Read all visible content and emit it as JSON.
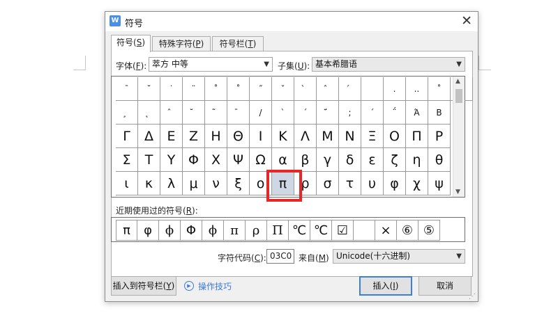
{
  "dialog": {
    "title": "符号",
    "app_icon_letter": "W",
    "close_glyph": "✕",
    "tabs": [
      {
        "label": "符号(",
        "key": "S",
        "tail": ")"
      },
      {
        "label": "特殊字符(",
        "key": "P",
        "tail": ")"
      },
      {
        "label": "符号栏(",
        "key": "T",
        "tail": ")"
      }
    ],
    "font_label": "字体(",
    "font_key": "F",
    "font_tail": "):",
    "font_value": "萃方 中等",
    "subset_label": "子集(",
    "subset_key": "U",
    "subset_tail": "):",
    "subset_value": "基本希腊语",
    "combo_arrow": "▼",
    "grid": [
      [
        "ˉ",
        "˘",
        "˙",
        "¨",
        "˚",
        "˚",
        "˝",
        "ˇ",
        "̀",
        "̂",
        "́",
        "",
        ".",
        "..",
        "˚",
        "̦"
      ],
      [
        "̧",
        "̨",
        "̂",
        "̆",
        "̃",
        "̄",
        "/",
        "`",
        "´",
        "̈́",
        ";",
        "΄",
        "΅",
        "Ά",
        "Β"
      ],
      [
        "Γ",
        "Δ",
        "Ε",
        "Ζ",
        "Η",
        "Θ",
        "Ι",
        "Κ",
        "Λ",
        "Μ",
        "Ν",
        "Ξ",
        "Ο",
        "Π",
        "Ρ"
      ],
      [
        "Σ",
        "Τ",
        "Υ",
        "Φ",
        "Χ",
        "Ψ",
        "Ω",
        "α",
        "β",
        "γ",
        "δ",
        "ε",
        "ζ",
        "η",
        "θ"
      ],
      [
        "ι",
        "κ",
        "λ",
        "μ",
        "ν",
        "ξ",
        "ο",
        "π",
        "ρ",
        "σ",
        "τ",
        "υ",
        "φ",
        "χ",
        "ψ"
      ]
    ],
    "selected_char": "π",
    "scroll_up": "▲",
    "scroll_down": "▼",
    "recent_label": "近期使用过的符号(",
    "recent_key": "R",
    "recent_tail": "):",
    "recent": [
      "π",
      "φ",
      "ϕ",
      "Φ",
      "ϕ",
      "π",
      "ρ",
      "Π",
      "℃",
      "℃",
      "☑",
      "",
      "×",
      "⑥",
      "⑤"
    ],
    "charcode_label": "字符代码(",
    "charcode_key": "C",
    "charcode_tail": "):",
    "charcode_value": "03C0",
    "from_label": "来自(",
    "from_key": "M",
    "from_tail": ")",
    "from_value": "Unicode(十六进制)",
    "insert_to_bar": "插入到符号栏(",
    "insert_to_bar_key": "Y",
    "insert_to_bar_tail": ")",
    "tips": "操作技巧",
    "tips_icon": "▶",
    "insert": "插入(",
    "insert_key": "I",
    "insert_tail": ")",
    "cancel": "取消"
  }
}
